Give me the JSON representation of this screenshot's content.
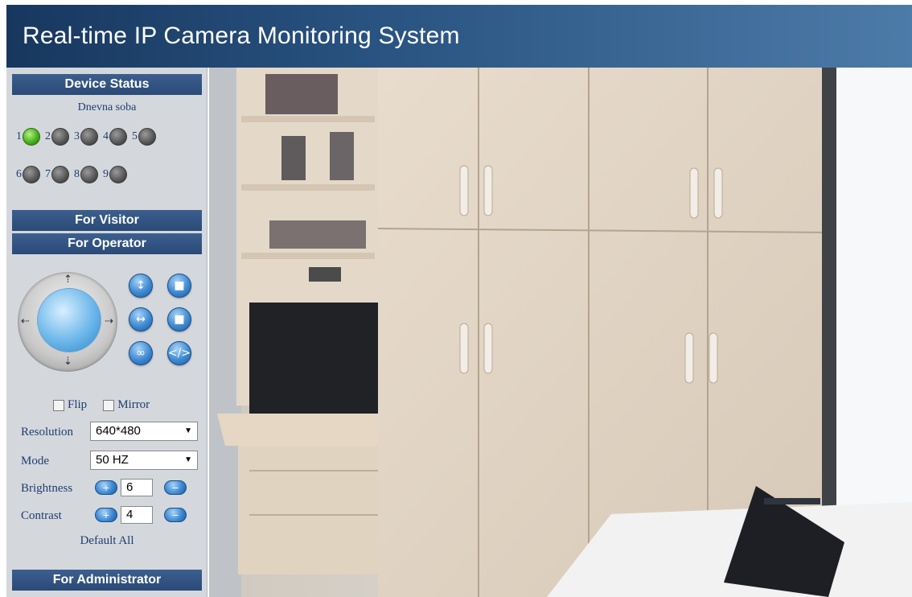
{
  "header": {
    "title": "Real-time IP Camera Monitoring System"
  },
  "sidebar": {
    "device_status": {
      "title": "Device Status",
      "device_name": "Dnevna soba",
      "devices": [
        {
          "num": "1",
          "active": true
        },
        {
          "num": "2",
          "active": false
        },
        {
          "num": "3",
          "active": false
        },
        {
          "num": "4",
          "active": false
        },
        {
          "num": "5",
          "active": false
        },
        {
          "num": "6",
          "active": false
        },
        {
          "num": "7",
          "active": false
        },
        {
          "num": "8",
          "active": false
        },
        {
          "num": "9",
          "active": false
        }
      ]
    },
    "for_visitor": "For Visitor",
    "for_operator": "For Operator",
    "controls": {
      "flip_label": "Flip",
      "mirror_label": "Mirror",
      "resolution_label": "Resolution",
      "resolution_value": "640*480",
      "mode_label": "Mode",
      "mode_value": "50 HZ",
      "brightness_label": "Brightness",
      "brightness_value": "6",
      "contrast_label": "Contrast",
      "contrast_value": "4",
      "default_all": "Default All"
    },
    "for_administrator": "For Administrator"
  },
  "colors": {
    "header_dark": "#17375e",
    "header_light": "#4d7ba8",
    "section_bar": "#2a4a77",
    "sidebar_bg": "#d4d8dd",
    "led_on": "#47b21b"
  }
}
